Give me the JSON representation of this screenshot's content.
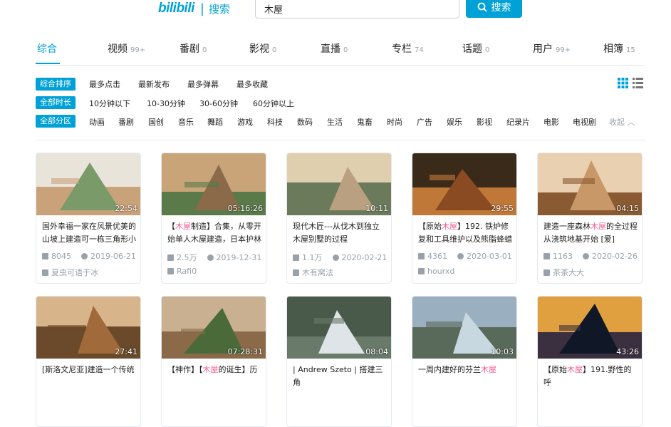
{
  "header": {
    "logo_text": "bilibili",
    "logo_sub": "搜索",
    "search_value": "木屋",
    "search_button": "搜索"
  },
  "tabs": [
    {
      "label": "综合",
      "count": ""
    },
    {
      "label": "视频",
      "count": "99+"
    },
    {
      "label": "番剧",
      "count": "0"
    },
    {
      "label": "影视",
      "count": "0"
    },
    {
      "label": "直播",
      "count": "0"
    },
    {
      "label": "专栏",
      "count": "74"
    },
    {
      "label": "话题",
      "count": "0"
    },
    {
      "label": "用户",
      "count": "99+"
    },
    {
      "label": "相簿",
      "count": "15"
    }
  ],
  "filters": {
    "order": {
      "tag": "综合排序",
      "options": [
        "最多点击",
        "最新发布",
        "最多弹幕",
        "最多收藏"
      ]
    },
    "duration": {
      "tag": "全部时长",
      "options": [
        "10分钟以下",
        "10-30分钟",
        "30-60分钟",
        "60分钟以上"
      ]
    },
    "zone": {
      "tag": "全部分区",
      "options": [
        "动画",
        "番剧",
        "国创",
        "音乐",
        "舞蹈",
        "游戏",
        "科技",
        "数码",
        "生活",
        "鬼畜",
        "时尚",
        "广告",
        "娱乐",
        "影视",
        "纪录片",
        "电影",
        "电视剧"
      ],
      "collapse": "收起"
    }
  },
  "videos": [
    {
      "duration": "22:54",
      "title_pre": "国外幸福一家在风景优美的山坡上建造可一栋三角形小",
      "title_hl": "",
      "title_post": "",
      "views": "8045",
      "date": "2019-06-21",
      "author": "夏虫可语于冰",
      "colors": [
        "#7a9a6a",
        "#caa27a",
        "#e8e4da"
      ]
    },
    {
      "duration": "05:16:26",
      "title_pre": "【",
      "title_hl": "木屋",
      "title_post": "制造】合集，从零开始单人木屋建造，日本护林",
      "views": "2.5万",
      "date": "2019-12-31",
      "author": "Rafi0",
      "colors": [
        "#8a6a48",
        "#5a7a4a",
        "#c8a478"
      ]
    },
    {
      "duration": "10:11",
      "title_pre": "现代木匠---从伐木到独立木屋别墅的过程",
      "title_hl": "",
      "title_post": "",
      "views": "1.1万",
      "date": "2020-02-21",
      "author": "木有窝法",
      "colors": [
        "#b8a080",
        "#6a7a5a",
        "#e0cfae"
      ]
    },
    {
      "duration": "29:55",
      "title_pre": "【原始",
      "title_hl": "木屋",
      "title_post": "】192. 铁炉修复和工具维护以及熊脂蜂蜡",
      "views": "4361",
      "date": "2020-03-01",
      "author": "hourxd",
      "colors": [
        "#8a4a22",
        "#c07838",
        "#3a2a1a"
      ]
    },
    {
      "duration": "04:15",
      "title_pre": "建造一座森林",
      "title_hl": "木屋",
      "title_post": "的全过程从浇筑地基开始 [爱]",
      "views": "1163",
      "date": "2020-02-26",
      "author": "茶茶大大",
      "colors": [
        "#c89868",
        "#8a5a32",
        "#e8d0b0"
      ]
    },
    {
      "duration": "27:41",
      "title_pre": "[斯洛文尼亚]建造一个传统",
      "title_hl": "",
      "title_post": "",
      "views": "",
      "date": "",
      "author": "",
      "colors": [
        "#a06a3a",
        "#6a4a2a",
        "#d8b48a"
      ]
    },
    {
      "duration": "07:28:31",
      "title_pre": "【神作】【",
      "title_hl": "木屋",
      "title_post": "的诞生】历",
      "views": "",
      "date": "",
      "author": "",
      "colors": [
        "#4a6a3a",
        "#8a6a48",
        "#c8b090"
      ]
    },
    {
      "duration": "08:04",
      "title_pre": "| Andrew Szeto | 搭建三角",
      "title_hl": "",
      "title_post": "",
      "views": "",
      "date": "",
      "author": "",
      "colors": [
        "#dfe4e8",
        "#6a7a6a",
        "#4a5a4a"
      ]
    },
    {
      "duration": "10:03",
      "title_pre": "一周内建好的芬兰",
      "title_hl": "木屋",
      "title_post": "",
      "views": "",
      "date": "",
      "author": "",
      "colors": [
        "#c8d8e0",
        "#5a6a5a",
        "#9ab0c0"
      ]
    },
    {
      "duration": "43:26",
      "title_pre": "【原始",
      "title_hl": "木屋",
      "title_post": "】191.野性的呼",
      "views": "",
      "date": "",
      "author": "",
      "colors": [
        "#101828",
        "#3a3040",
        "#e0a040"
      ]
    }
  ]
}
